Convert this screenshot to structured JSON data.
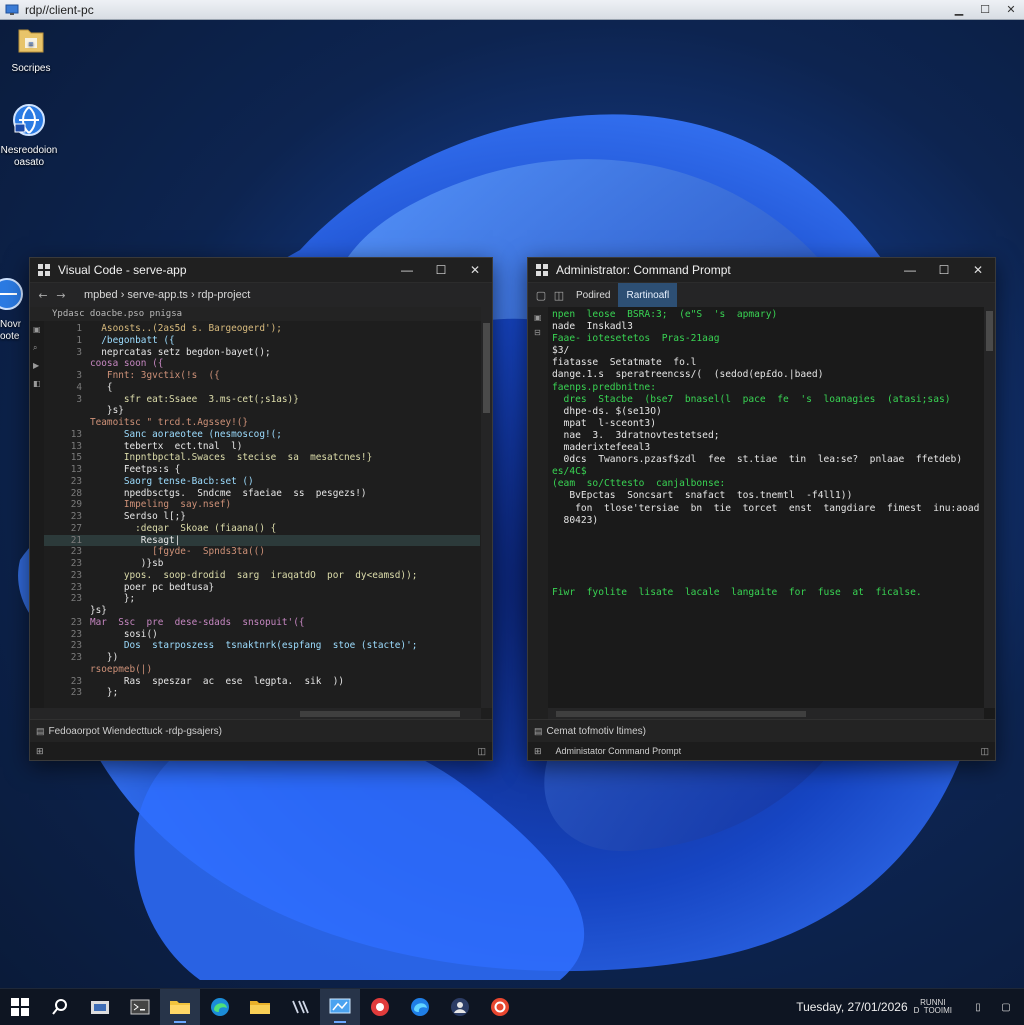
{
  "rdp": {
    "title": "rdp//client-pc",
    "controls": [
      "▁",
      "☐",
      "✕"
    ]
  },
  "desktop": {
    "icons": [
      {
        "label": "Socripes"
      },
      {
        "label": "Nesreodoion oasato"
      },
      {
        "label": "Novr oote"
      }
    ]
  },
  "vscode": {
    "title": "Visual Code - serve-app",
    "controls": [
      "—",
      "☐",
      "✕"
    ],
    "toolbar": {
      "back": "←",
      "forward": "→",
      "path": "mpbed › serve-app.ts › rdp-project"
    },
    "editor_header": "Ypdasc doacbe.pso pnigsa",
    "lines": [
      {
        "n": "1",
        "t": "  Asoosts..(2as5d s. Bargeogerd');",
        "c": "#d7ba7d"
      },
      {
        "n": "1",
        "t": "  /begonbatt ({",
        "c": "#9cdcfe"
      },
      {
        "n": "3",
        "t": "  neprcatas setz begdon-bayet();",
        "c": "#e6e6e6"
      },
      {
        "n": "",
        "t": "coosa soon ({",
        "c": "#c586c0"
      },
      {
        "n": "3",
        "t": "   Fnnt: 3gvctix(!s  ({",
        "c": "#ce9178"
      },
      {
        "n": "4",
        "t": "   {",
        "c": "#e6e6e6"
      },
      {
        "n": "3",
        "t": "      sfr eat:Ssaee  3.ms-cet(;s1as)}",
        "c": "#dcdcaa"
      },
      {
        "n": "",
        "t": "   }s}",
        "c": "#e6e6e6"
      },
      {
        "n": "",
        "t": "Teamoitsc \" trcd.t.Agssey!(}",
        "c": "#ce9178"
      },
      {
        "n": "13",
        "t": "      Sanc aoraeotee (nesmoscog!(;",
        "c": "#9cdcfe"
      },
      {
        "n": "13",
        "t": "      tebertx  ect.tnal  l)",
        "c": "#e6e6e6"
      },
      {
        "n": "15",
        "t": "      Inpntbpctal.Swaces  stecise  sa  mesatcnes!}",
        "c": "#dcdcaa"
      },
      {
        "n": "13",
        "t": "      Feetps:s {",
        "c": "#e6e6e6"
      },
      {
        "n": "23",
        "t": "      Saorg tense-Bacb:set ()",
        "c": "#9cdcfe"
      },
      {
        "n": "28",
        "t": "      npedbsctgs.  Sndcme  sfaeiae  ss  pesgezs!)",
        "c": "#e6e6e6"
      },
      {
        "n": "29",
        "t": "      Impeling  say.nsef)",
        "c": "#ce9178"
      },
      {
        "n": "23",
        "t": "      Serdso l[;}",
        "c": "#e6e6e6"
      },
      {
        "n": "27",
        "t": "        :deqar  Skoae (fiaana() {",
        "c": "#dcdcaa"
      },
      {
        "n": "21",
        "t": "         Resagt|",
        "c": "#e6e6e6",
        "hl": true
      },
      {
        "n": "23",
        "t": "           [fgyde-  Spnds3ta(()",
        "c": "#ce9178"
      },
      {
        "n": "23",
        "t": "         )}sb",
        "c": "#e6e6e6"
      },
      {
        "n": "23",
        "t": "      ypos.  soop-drodid  sarg  iraqatdO  por  dy<eamsd));",
        "c": "#dcdcaa"
      },
      {
        "n": "23",
        "t": "      poer pc bedtusa}",
        "c": "#e6e6e6"
      },
      {
        "n": "23",
        "t": "      };",
        "c": "#e6e6e6"
      },
      {
        "n": "",
        "t": "}s}",
        "c": "#e6e6e6"
      },
      {
        "n": "23",
        "t": "Mar  Ssc  pre  dese-sdads  snsopuit'({",
        "c": "#c586c0"
      },
      {
        "n": "23",
        "t": "      sosi()",
        "c": "#e6e6e6"
      },
      {
        "n": "23",
        "t": "      Dos  starposzess  tsnaktnrk(espfang  stoe (stacte)';",
        "c": "#9cdcfe"
      },
      {
        "n": "23",
        "t": "   })",
        "c": "#e6e6e6"
      },
      {
        "n": "",
        "t": "rsoepmeb(|)",
        "c": "#ce9178"
      },
      {
        "n": "23",
        "t": "      Ras  speszar  ac  ese  legpta.  sik  ))",
        "c": "#e6e6e6"
      },
      {
        "n": "23",
        "t": "   };",
        "c": "#e6e6e6"
      }
    ],
    "status": "Fedoaorpot Wiendecttuck -rdp-gsajers)"
  },
  "cmd": {
    "title": "Administrator: Command Prompt",
    "controls": [
      "—",
      "☐",
      "✕"
    ],
    "tabs": [
      {
        "label": "Podired",
        "active": false
      },
      {
        "label": "Rartinoafl",
        "active": true
      }
    ],
    "lines": [
      {
        "t": "npen  leose  BSRA:3;  (e\"S  's  apmary)",
        "c": "#39d353"
      },
      {
        "t": "nade  Inskadl3",
        "c": "#e6e6e6"
      },
      {
        "t": "Faae- iotesetetos  Pras-21aag",
        "c": "#39d353"
      },
      {
        "t": "$3/",
        "c": "#e6e6e6"
      },
      {
        "t": "fiatasse  Setatmate  fo.l",
        "c": "#e6e6e6"
      },
      {
        "t": "dange.1.s  speratreencss/(  (sedod(ep£do.|baed)",
        "c": "#e6e6e6"
      },
      {
        "t": "faenps.predbnitne:",
        "c": "#39d353"
      },
      {
        "t": "  dres  Stacbe  (bse7  bnasel(l  pace  fe  's  loanagies  (atasi;sas)",
        "c": "#39d353"
      },
      {
        "t": "  dhpe-ds. $(se13O)",
        "c": "#e6e6e6"
      },
      {
        "t": "  mpat  l-sceont3)",
        "c": "#e6e6e6"
      },
      {
        "t": "  nae  3.  3dratnovtestetsed;",
        "c": "#e6e6e6"
      },
      {
        "t": "  maderixtefeeal3",
        "c": "#e6e6e6"
      },
      {
        "t": "  0dcs  Twanors.pzasf$zdl  fee  st.tiae  tin  lea:se?  pnlaae  ffetdeb)",
        "c": "#e6e6e6"
      },
      {
        "t": "es/4C$",
        "c": "#39d353"
      },
      {
        "t": "(eam  so/Cttesto  canjalbonse:",
        "c": "#39d353"
      },
      {
        "t": "   BvEpctas  Soncsart  snafact  tos.tnemtl  -f4ll1))",
        "c": "#e6e6e6"
      },
      {
        "t": "    fon  tlose'tersiae  bn  tie  torcet  enst  tangdiare  fimest  inu:aoad  amd  feetin",
        "c": "#e6e6e6"
      },
      {
        "t": "  80423)",
        "c": "#e6e6e6"
      },
      {
        "t": "",
        "c": "#e6e6e6"
      },
      {
        "t": "",
        "c": "#e6e6e6"
      },
      {
        "t": "",
        "c": "#e6e6e6"
      },
      {
        "t": "",
        "c": "#e6e6e6"
      },
      {
        "t": "",
        "c": "#e6e6e6"
      },
      {
        "t": "Fiwr  fyolite  lisate  lacale  langaite  for  fuse  at  ficalse.",
        "c": "#39d353"
      }
    ],
    "status": "Cemat tofmotiv ltimes)",
    "bottom": "Administator Command Prompt"
  },
  "taskbar": {
    "clock": "Tuesday, 27/01/2026",
    "tray_extra": "RUNNI\nD  TOOIMI"
  },
  "colors": {
    "accent": "#3b78ff",
    "cmd_green": "#39d353",
    "tab_active": "#2d4f74"
  }
}
